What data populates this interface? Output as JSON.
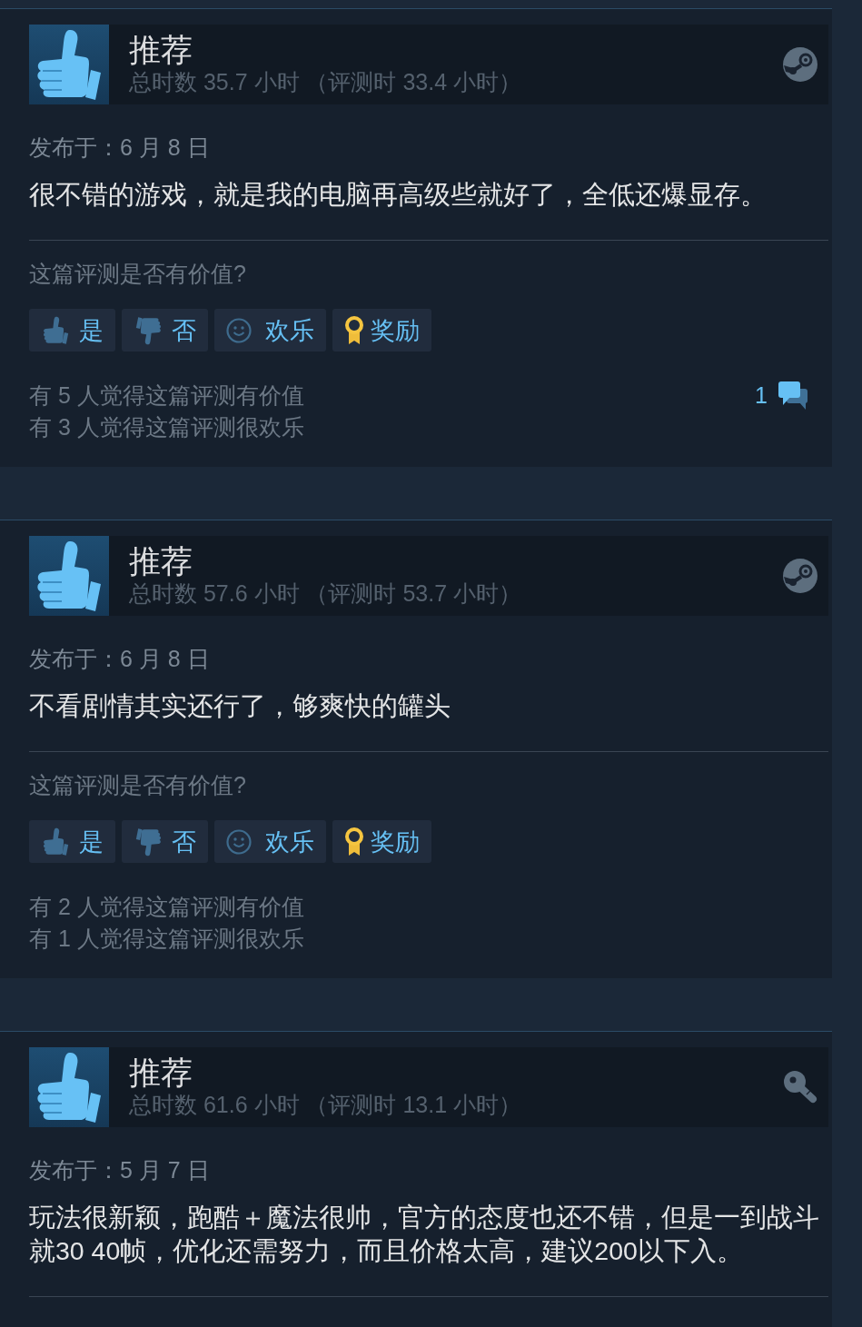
{
  "reviews": [
    {
      "recommended": true,
      "verdict": "推荐",
      "hours": "总时数 35.7 小时 （评测时 33.4 小时）",
      "kind": "steam",
      "posted": "发布于：6 月 8 日",
      "text": "很不错的游戏，就是我的电脑再高级些就好了，全低还爆显存。",
      "question": "这篇评测是否有价值?",
      "buttons": [
        {
          "kind": "yes",
          "label": "是"
        },
        {
          "kind": "no",
          "label": "否"
        },
        {
          "kind": "funny",
          "label": "欢乐"
        },
        {
          "kind": "award",
          "label": "奖励"
        }
      ],
      "stats": [
        "有 5 人觉得这篇评测有价值",
        "有 3 人觉得这篇评测很欢乐"
      ],
      "comment_count": "1"
    },
    {
      "recommended": true,
      "verdict": "推荐",
      "hours": "总时数 57.6 小时 （评测时 53.7 小时）",
      "kind": "steam",
      "posted": "发布于：6 月 8 日",
      "text": "不看剧情其实还行了，够爽快的罐头",
      "question": "这篇评测是否有价值?",
      "buttons": [
        {
          "kind": "yes",
          "label": "是"
        },
        {
          "kind": "no",
          "label": "否"
        },
        {
          "kind": "funny",
          "label": "欢乐"
        },
        {
          "kind": "award",
          "label": "奖励"
        }
      ],
      "stats": [
        "有 2 人觉得这篇评测有价值",
        "有 1 人觉得这篇评测很欢乐"
      ]
    },
    {
      "recommended": true,
      "verdict": "推荐",
      "hours": "总时数 61.6 小时 （评测时 13.1 小时）",
      "kind": "key",
      "posted": "发布于：5 月 7 日",
      "text": "玩法很新颖，跑酷＋魔法很帅，官方的态度也还不错，但是一到战斗就30 40帧，优化还需努力，而且价格太高，建议200以下入。"
    }
  ]
}
